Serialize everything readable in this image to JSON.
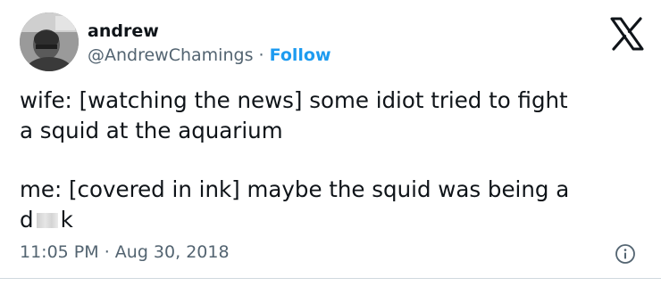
{
  "tweet": {
    "author_name": "andrew",
    "handle": "@AndrewChamings",
    "separator": "·",
    "follow_label": "Follow",
    "body_line1": "wife: [watching the news] some idiot tried to fight",
    "body_line2": "a squid at the aquarium",
    "body_line3": "me: [covered in ink] maybe the squid was being a",
    "body_line4_start": "d",
    "body_line4_end": "k",
    "time": "11:05 PM",
    "date": "Aug 30, 2018"
  },
  "icons": {
    "brand": "x-logo-icon",
    "info": "info-icon",
    "avatar": "avatar-photo"
  },
  "colors": {
    "accent": "#1d9bf0",
    "secondary_text": "#536471",
    "primary_text": "#0f1419",
    "divider": "#cfd9de"
  }
}
